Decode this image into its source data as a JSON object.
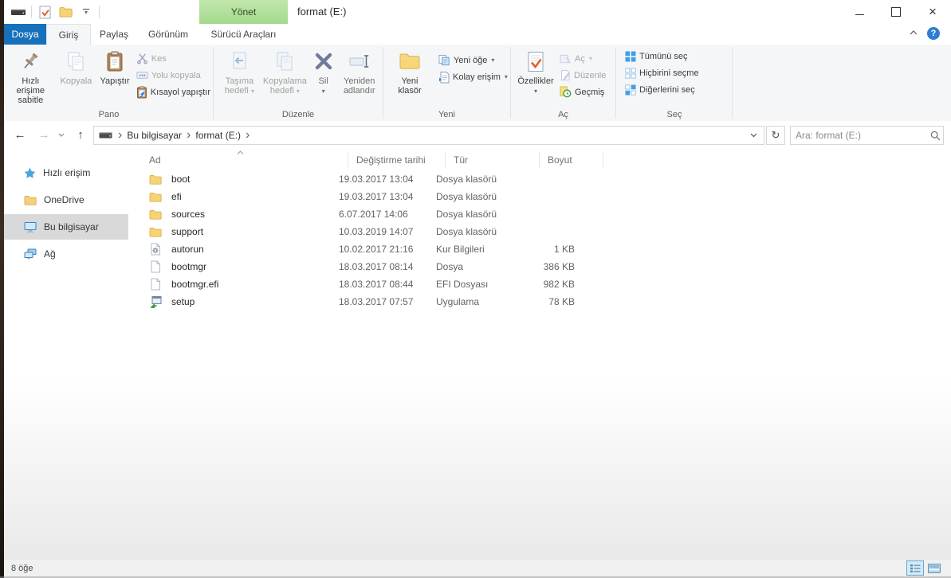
{
  "window": {
    "title": "format (E:)",
    "contextual_tab": "Yönet",
    "help": "?"
  },
  "glyphs": {
    "back": "←",
    "forward": "→",
    "up": "↑",
    "dropdown": "▾",
    "refresh": "↻",
    "breadcrumb_sep": "›",
    "minimize": "–",
    "close": "×"
  },
  "tabs": [
    {
      "label": "Dosya"
    },
    {
      "label": "Giriş"
    },
    {
      "label": "Paylaş"
    },
    {
      "label": "Görünüm"
    },
    {
      "label": "Sürücü Araçları"
    }
  ],
  "ribbon": {
    "pano": {
      "label": "Pano",
      "pin": "Hızlı erişime sabitle",
      "copy": "Kopyala",
      "paste": "Yapıştır",
      "cut": "Kes",
      "copy_path": "Yolu kopyala",
      "paste_shortcut": "Kısayol yapıştır"
    },
    "duzenle": {
      "label": "Düzenle",
      "move_to": "Taşıma hedefi",
      "copy_to": "Kopyalama hedefi",
      "delete": "Sil",
      "rename": "Yeniden adlandır"
    },
    "yeni": {
      "label": "Yeni",
      "new_folder": "Yeni klasör",
      "new_item": "Yeni öğe",
      "easy_access": "Kolay erişim"
    },
    "ac": {
      "label": "Aç",
      "properties": "Özellikler",
      "open": "Aç",
      "edit": "Düzenle",
      "history": "Geçmiş"
    },
    "sec": {
      "label": "Seç",
      "select_all": "Tümünü seç",
      "select_none": "Hiçbirini seçme",
      "invert": "Diğerlerini seç"
    }
  },
  "navbar": {
    "breadcrumb": [
      "Bu bilgisayar",
      "format (E:)"
    ],
    "search_placeholder": "Ara: format (E:)"
  },
  "sidebar": {
    "items": [
      {
        "label": "Hızlı erişim",
        "icon": "star-icon"
      },
      {
        "label": "OneDrive",
        "icon": "onedrive-folder-icon"
      },
      {
        "label": "Bu bilgisayar",
        "icon": "computer-icon",
        "selected": true
      },
      {
        "label": "Ağ",
        "icon": "network-icon"
      }
    ]
  },
  "files": {
    "columns": [
      "Ad",
      "Değiştirme tarihi",
      "Tür",
      "Boyut"
    ],
    "rows": [
      {
        "name": "boot",
        "date": "19.03.2017 13:04",
        "type": "Dosya klasörü",
        "size": "",
        "icon": "folder-icon"
      },
      {
        "name": "efi",
        "date": "19.03.2017 13:04",
        "type": "Dosya klasörü",
        "size": "",
        "icon": "folder-icon"
      },
      {
        "name": "sources",
        "date": "6.07.2017 14:06",
        "type": "Dosya klasörü",
        "size": "",
        "icon": "folder-icon"
      },
      {
        "name": "support",
        "date": "10.03.2019 14:07",
        "type": "Dosya klasörü",
        "size": "",
        "icon": "folder-icon"
      },
      {
        "name": "autorun",
        "date": "10.02.2017 21:16",
        "type": "Kur Bilgileri",
        "size": "1 KB",
        "icon": "setup-info-icon"
      },
      {
        "name": "bootmgr",
        "date": "18.03.2017 08:14",
        "type": "Dosya",
        "size": "386 KB",
        "icon": "file-icon"
      },
      {
        "name": "bootmgr.efi",
        "date": "18.03.2017 08:44",
        "type": "EFI Dosyası",
        "size": "982 KB",
        "icon": "file-icon"
      },
      {
        "name": "setup",
        "date": "18.03.2017 07:57",
        "type": "Uygulama",
        "size": "78 KB",
        "icon": "app-icon"
      }
    ]
  },
  "statusbar": {
    "item_count": "8 öğe"
  }
}
